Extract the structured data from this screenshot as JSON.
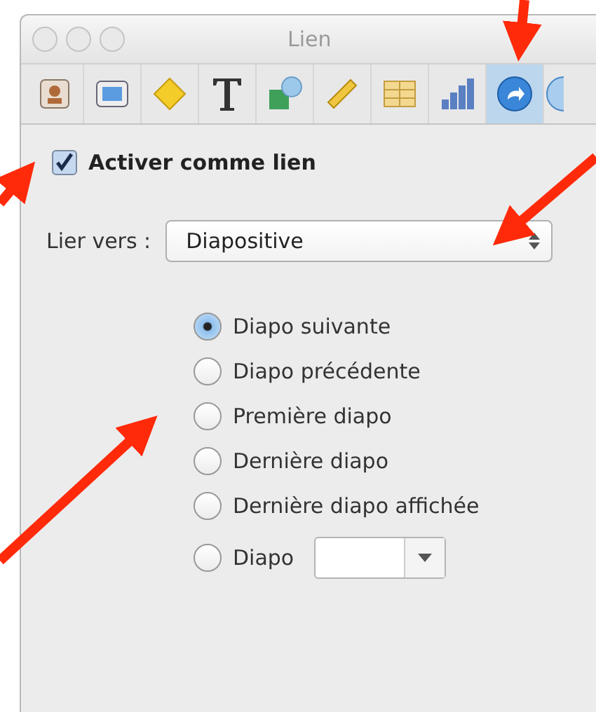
{
  "window": {
    "title": "Lien"
  },
  "toolbar": [
    {
      "kind": "document",
      "selected": false
    },
    {
      "kind": "slide",
      "selected": false
    },
    {
      "kind": "transition",
      "selected": false
    },
    {
      "kind": "text",
      "selected": false
    },
    {
      "kind": "graphic",
      "selected": false
    },
    {
      "kind": "metrics",
      "selected": false
    },
    {
      "kind": "table",
      "selected": false
    },
    {
      "kind": "chart",
      "selected": false
    },
    {
      "kind": "hyperlink",
      "selected": true
    },
    {
      "kind": "media",
      "selected": false
    }
  ],
  "enable_link": {
    "label": "Activer comme lien",
    "checked": true
  },
  "link_to": {
    "label": "Lier vers :",
    "value": "Diapositive"
  },
  "options": [
    {
      "kind": "plain",
      "label": "Diapo suivante",
      "selected": true
    },
    {
      "kind": "plain",
      "label": "Diapo précédente",
      "selected": false
    },
    {
      "kind": "plain",
      "label": "Première diapo",
      "selected": false
    },
    {
      "kind": "plain",
      "label": "Dernière diapo",
      "selected": false
    },
    {
      "kind": "plain",
      "label": "Dernière diapo affichée",
      "selected": false
    },
    {
      "kind": "with_field",
      "label": "Diapo",
      "selected": false
    }
  ]
}
